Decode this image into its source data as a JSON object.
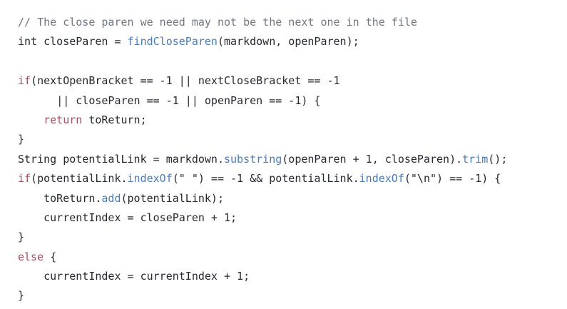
{
  "code": {
    "comment": "// The close paren we need may not be the next one in the file",
    "l2_type": "int",
    "l2_var": "closeParen",
    "l2_eq": " = ",
    "l2_fn": "findCloseParen",
    "l2_args": "(markdown, openParen);",
    "l4_kw": "if",
    "l4_rest": "(nextOpenBracket == -1 || nextCloseBracket == -1",
    "l5_rest": "|| closeParen == -1 || openParen == -1) {",
    "l6_kw": "return",
    "l6_rest": " toReturn;",
    "l7": "}",
    "l8_a": "String potentialLink = markdown.",
    "l8_fn1": "substring",
    "l8_b": "(openParen + 1, closeParen).",
    "l8_fn2": "trim",
    "l8_c": "();",
    "l9_kw": "if",
    "l9_a": "(potentialLink.",
    "l9_fn1": "indexOf",
    "l9_b": "(\" \") == -1 && potentialLink.",
    "l9_fn2": "indexOf",
    "l9_c": "(\"\\n\") == -1) {",
    "l10_a": "toReturn.",
    "l10_fn": "add",
    "l10_b": "(potentialLink);",
    "l11": "currentIndex = closeParen + 1;",
    "l12": "}",
    "l13_kw": "else",
    "l13_b": " {",
    "l14": "currentIndex = currentIndex + 1;",
    "l15": "}"
  }
}
